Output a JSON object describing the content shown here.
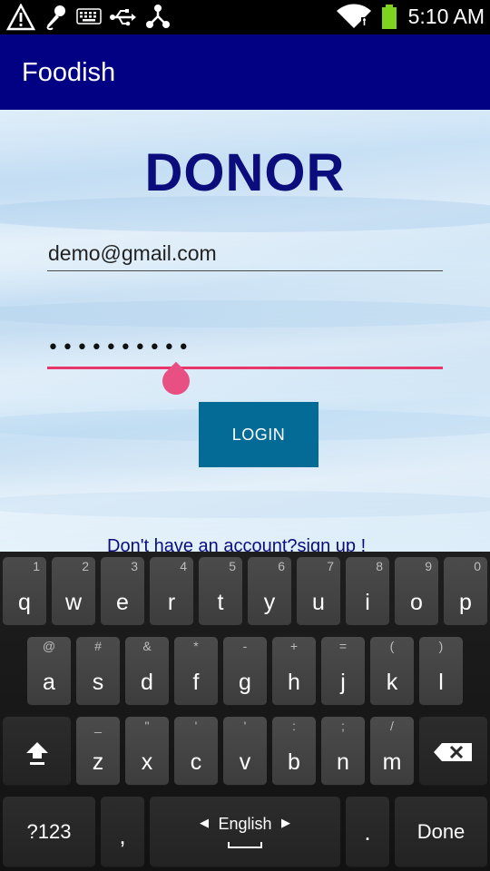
{
  "status_bar": {
    "time": "5:10 AM",
    "icons": [
      "warning-icon",
      "microphone-icon",
      "keyboard-icon",
      "usb-icon",
      "share-icon",
      "wifi-icon",
      "battery-icon"
    ]
  },
  "app_bar": {
    "title": "Foodish"
  },
  "form": {
    "heading": "DONOR",
    "email_value": "demo@gmail.com",
    "password_masked": "••••••••••",
    "login_label": "LOGIN",
    "signup_text": "Don't have an account?sign up !"
  },
  "colors": {
    "app_bar": "#020083",
    "heading": "#0b0d7d",
    "login_button": "#046b96",
    "focus_accent": "#e8366b"
  },
  "keyboard": {
    "row1": [
      {
        "key": "q",
        "hint": "1"
      },
      {
        "key": "w",
        "hint": "2"
      },
      {
        "key": "e",
        "hint": "3"
      },
      {
        "key": "r",
        "hint": "4"
      },
      {
        "key": "t",
        "hint": "5"
      },
      {
        "key": "y",
        "hint": "6"
      },
      {
        "key": "u",
        "hint": "7"
      },
      {
        "key": "i",
        "hint": "8"
      },
      {
        "key": "o",
        "hint": "9"
      },
      {
        "key": "p",
        "hint": "0"
      }
    ],
    "row2": [
      {
        "key": "a",
        "hint": "@"
      },
      {
        "key": "s",
        "hint": "#"
      },
      {
        "key": "d",
        "hint": "&"
      },
      {
        "key": "f",
        "hint": "*"
      },
      {
        "key": "g",
        "hint": "-"
      },
      {
        "key": "h",
        "hint": "+"
      },
      {
        "key": "j",
        "hint": "="
      },
      {
        "key": "k",
        "hint": "("
      },
      {
        "key": "l",
        "hint": ")"
      }
    ],
    "row3": [
      {
        "key": "z",
        "hint": "_"
      },
      {
        "key": "x",
        "hint": "\""
      },
      {
        "key": "c",
        "hint": "'"
      },
      {
        "key": "v",
        "hint": "'"
      },
      {
        "key": "b",
        "hint": ":"
      },
      {
        "key": "n",
        "hint": ";"
      },
      {
        "key": "m",
        "hint": "/"
      }
    ],
    "symbols_label": "?123",
    "comma_label": ",",
    "language_label": "English",
    "period_label": ".",
    "done_label": "Done",
    "shift_icon": "shift-icon",
    "backspace_icon": "backspace-icon"
  }
}
